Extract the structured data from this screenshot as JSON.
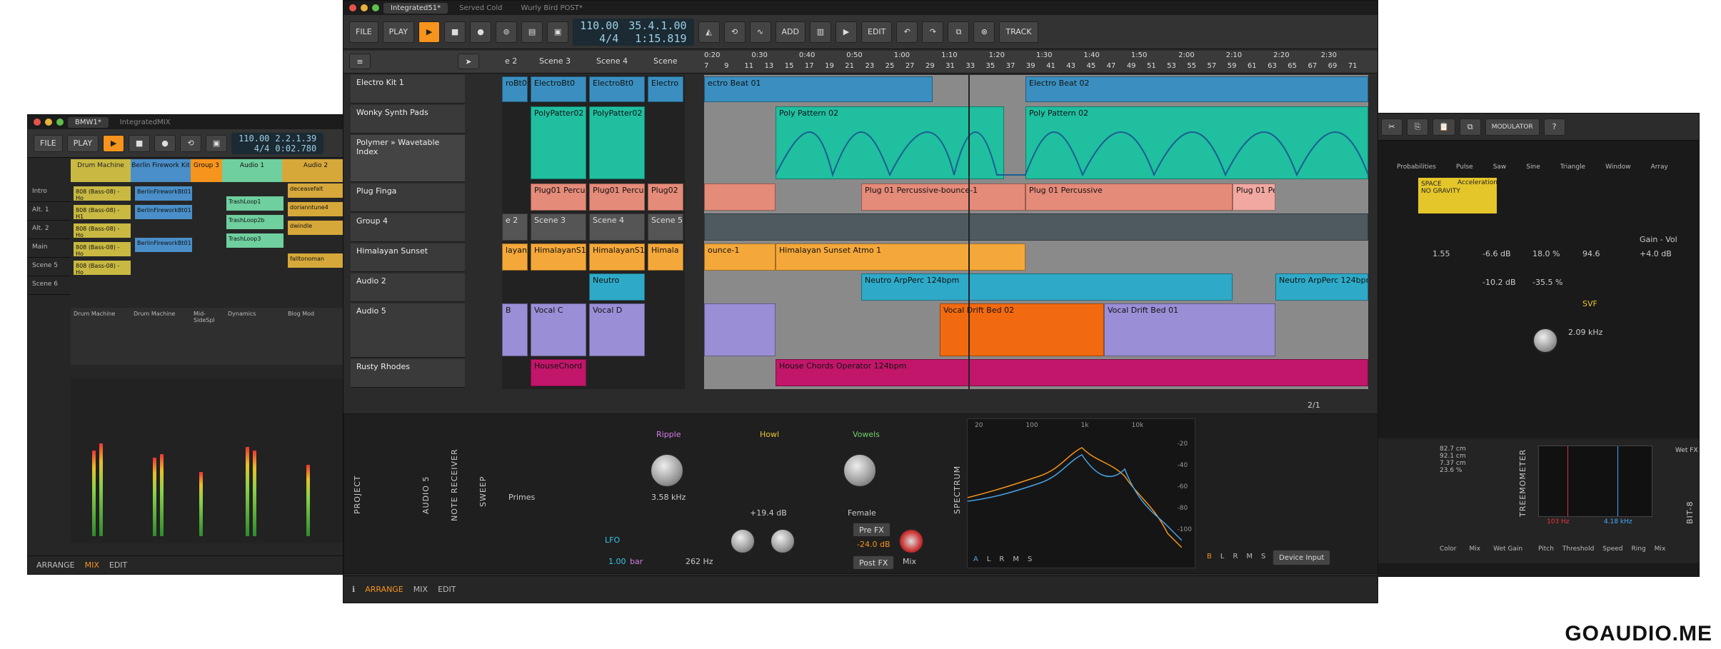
{
  "main": {
    "tabs": [
      "Integrated51*",
      "Served Cold",
      "Wurly Bird POST*"
    ],
    "toolbar": {
      "file": "FILE",
      "play": "PLAY",
      "add": "ADD",
      "edit": "EDIT",
      "track": "TRACK"
    },
    "transport": {
      "tempo": "110.00",
      "sig": "4/4",
      "pos_bars": "35.4.1.00",
      "pos_time": "1:15.819"
    },
    "scenes": [
      "e 2",
      "Scene 3",
      "Scene 4",
      "Scene"
    ],
    "ruler": [
      "0:20",
      "0:30",
      "0:40",
      "0:50",
      "1:00",
      "1:10",
      "1:20",
      "1:30",
      "1:40",
      "1:50",
      "2:00",
      "2:10",
      "2:20",
      "2:30"
    ],
    "bars": [
      "7",
      "9",
      "11",
      "13",
      "15",
      "17",
      "19",
      "21",
      "23",
      "25",
      "27",
      "29",
      "31",
      "33",
      "35",
      "37",
      "39",
      "41",
      "43",
      "45",
      "47",
      "49",
      "51",
      "53",
      "55",
      "57",
      "59",
      "61",
      "63",
      "65",
      "67",
      "69",
      "71"
    ],
    "tracks": [
      {
        "name": "Electro Kit 1"
      },
      {
        "name": "Wonky Synth Pads"
      },
      {
        "name": "Polymer » Wavetable Index"
      },
      {
        "name": "Plug Finga"
      },
      {
        "name": "Group 4"
      },
      {
        "name": "Himalayan Sunset"
      },
      {
        "name": "Audio 2"
      },
      {
        "name": "Audio 5"
      },
      {
        "name": "Rusty Rhodes"
      }
    ],
    "launcher": {
      "electro": [
        "roBt0",
        "ElectroBt0",
        "ElectroBt0",
        "Electro"
      ],
      "wonky": [
        "PolyPatter02",
        "PolyPatter02"
      ],
      "plug": [
        "Plug01 Percu",
        "Plug01 Percu",
        "Plug02"
      ],
      "group": [
        "e 2",
        "Scene 3",
        "Scene 4",
        "Scene 5"
      ],
      "himalayan": [
        "layanS1",
        "HimalayanS1",
        "HimalayanS1",
        "Himala"
      ],
      "audio2": [
        "Neutro"
      ],
      "audio5": [
        "B",
        "Vocal C",
        "Vocal D"
      ],
      "rhodes": [
        "HouseChord"
      ]
    },
    "clips": {
      "electro1": "ectro Beat 01",
      "electro2": "Electro Beat 02",
      "poly1": "Poly Pattern 02",
      "poly2": "Poly Pattern 02",
      "perc1": "Plug 01 Percussive-bounce-1",
      "perc2": "Plug 01 Percussive",
      "perc3": "Plug 01 Pe",
      "bounce": "ounce-1",
      "himalayan": "Himalayan Sunset Atmo 1",
      "neutro1": "Neutro ArpPerc 124bpm",
      "neutro2": "Neutro ArpPerc 124bpm",
      "vocal1": "Vocal Drift Bed 02",
      "vocal2": "Vocal Drift Bed 01",
      "house": "House Chords Operator 124bpm"
    },
    "page_indicator": "2/1",
    "devices": {
      "project": "PROJECT",
      "audio5": "AUDIO 5",
      "note_receiver": "NOTE RECEIVER",
      "sweep": "SWEEP",
      "spectrum": "SPECTRUM",
      "ripple": "Ripple",
      "ripple_freq": "3.58 kHz",
      "primes": "Primes",
      "howl": "Howl",
      "howl_gain": "+19.4 dB",
      "vowels": "Vowels",
      "female": "Female",
      "lfo": "LFO",
      "lfo_rate": "1.00",
      "lfo_unit": "bar",
      "cutoff": "262 Hz",
      "pre_fx": "Pre FX",
      "post_fx": "Post FX",
      "level": "-24.0 dB",
      "mix": "Mix",
      "spec_freqs": [
        "20",
        "100",
        "1k",
        "10k"
      ],
      "spec_db": [
        "-20",
        "-40",
        "-60",
        "-80",
        "-100"
      ],
      "spec_left": [
        "A",
        "L",
        "R",
        "M",
        "S"
      ],
      "spec_right": [
        "B",
        "L",
        "R",
        "M",
        "S"
      ],
      "device_input": "Device Input"
    },
    "status": [
      "ARRANGE",
      "MIX",
      "EDIT"
    ]
  },
  "left": {
    "tabs": [
      "BMW1*",
      "IntegratedMIX"
    ],
    "tempo": "110.00",
    "sig": "4/4",
    "pos": "2.2.1.39",
    "time": "0:02.780",
    "scenes": [
      "Intro",
      "Alt. 1",
      "Alt. 2",
      "Main",
      "Scene 5",
      "Scene 6"
    ],
    "columns": [
      "Drum Machine",
      "Berlin Firework Kit",
      "Group 3",
      "Audio 1",
      "Audio 2"
    ],
    "clips": [
      "808 (Bass-08) - Ho",
      "808 (Bass-08) - H1",
      "808 (Bass-08) - Ho",
      "808 (Bass-08) - Ho",
      "808 (Bass-08) - Ho",
      "BerlinFireworkBt01",
      "BerlinFireworkBt01",
      "BerlinFireworkBt01",
      "TrashLoop1",
      "TrashLoop2b",
      "TrashLoop3",
      "deceasefalt",
      "dorianntune4",
      "dwindle",
      "falltonoman"
    ],
    "devices": [
      "Drum Machine",
      "Drum Machine",
      "Mid-SideSpl",
      "Dynamics",
      "Blog Mod"
    ],
    "status": [
      "ARRANGE",
      "MIX",
      "EDIT"
    ]
  },
  "right": {
    "modulator": "MODULATOR",
    "mod_labels": [
      "Probabilities",
      "Pulse",
      "Saw",
      "Sine",
      "Triangle",
      "Window",
      "Array"
    ],
    "space": "SPACE",
    "no_gravity": "NO GRAVITY",
    "acceleration": "Acceleration",
    "mod_values": [
      "1.55",
      "-6.6 dB",
      "18.0 %",
      "94.6",
      "-10.2 dB",
      "-35.5 %"
    ],
    "svf": "SVF",
    "svf_freq": "2.09 kHz",
    "gain": "Gain - Vol",
    "gain_val": "+4.0 dB",
    "treemometer": "TREEMOMETER",
    "wet_fx": "Wet FX",
    "cutoff": [
      "82.7 cm",
      "92.1 cm",
      "7.37 cm",
      "23.6 %"
    ],
    "freqs": [
      "103 Hz",
      "4.18 kHz"
    ],
    "knobs": [
      "Pitch",
      "Threshold",
      "Speed",
      "Ring",
      "Mix",
      "Color",
      "Mix",
      "Wet Gain"
    ],
    "bit8": "BIT-8"
  },
  "watermark": "GOAUDIO.ME"
}
